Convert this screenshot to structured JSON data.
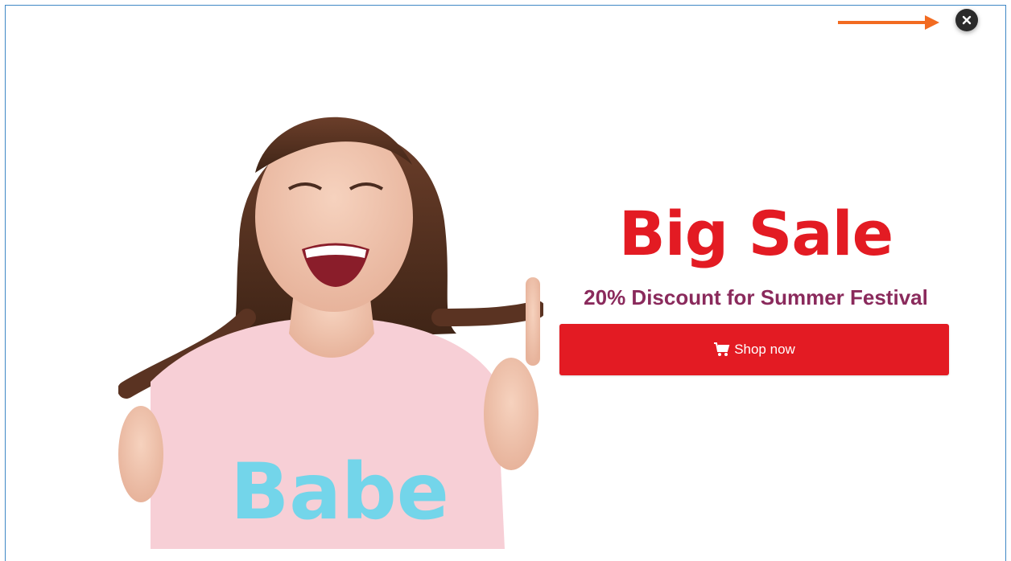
{
  "popup": {
    "headline": "Big Sale",
    "subheadline": "20% Discount for Summer Festival",
    "cta_label": "Shop now",
    "cta_icon": "cart-icon",
    "close_icon": "close-icon",
    "image_text": "Babe",
    "colors": {
      "accent": "#e31b23",
      "subhead": "#8a2a5c",
      "annotation_arrow": "#f26b21",
      "close_button": "#2b2b2b"
    }
  }
}
